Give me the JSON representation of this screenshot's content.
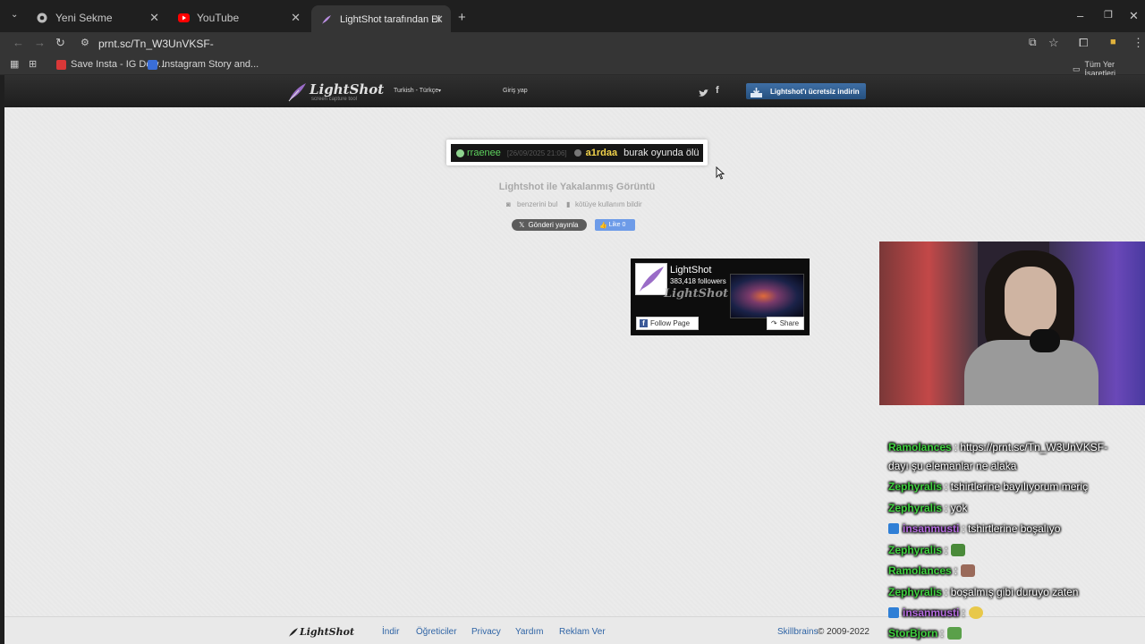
{
  "browser": {
    "tabs": [
      {
        "title": "Yeni Sekme",
        "icon": "chrome-icon"
      },
      {
        "title": "YouTube",
        "icon": "youtube-icon"
      },
      {
        "title": "LightShot tarafından Ekran Gör",
        "icon": "lightshot-feather-icon"
      }
    ],
    "url": "prnt.sc/Tn_W3UnVKSF-",
    "bookmarks": [
      {
        "label": "Save Insta - IG Dow...",
        "color": "#d93838"
      },
      {
        "label": "Instagram Story and...",
        "color": "#3a6ed8"
      }
    ],
    "all_bookmarks": "Tüm Yer İşaretleri"
  },
  "header": {
    "logo": "LightShot",
    "tagline": "screen capture tool",
    "language": "Turkish - Türkçe",
    "login": "Giriş yap",
    "download": "Lightshot'ı ücretsiz indirin"
  },
  "screenshot": {
    "user1": "rraenee",
    "timestamp": "[26/09/2025 21:06]",
    "user2": "a1rdaa",
    "message": "burak oyunda ölü"
  },
  "caption": "Lightshot ile Yakalanmış Görüntü",
  "actions": {
    "find_similar": "benzerini bul",
    "report": "kötüye kullanım bildir"
  },
  "share": {
    "tweet": "Gönderi yayınla",
    "like": "Like 0"
  },
  "fb_widget": {
    "name": "LightShot",
    "followers": "383,418 followers",
    "follow": "Follow Page",
    "share": "Share"
  },
  "footer": {
    "logo": "LightShot",
    "links": [
      "İndir",
      "Öğreticiler",
      "Privacy",
      "Yardım",
      "Reklam Ver"
    ],
    "company": "Skillbrains",
    "copyright": "© 2009-2022"
  },
  "stream_chat": [
    {
      "user": "Ramolances",
      "color": "#3fd13f",
      "text": ": https://prnt.sc/Tn_W3UnVKSF-"
    },
    {
      "user": "",
      "color": "#ffffff",
      "text": "dayı şu elemanlar ne alaka"
    },
    {
      "user": "Zephyralis",
      "color": "#3fd13f",
      "text": ": tshirtlerine bayılıyorum meriç"
    },
    {
      "user": "Zephyralis",
      "color": "#3fd13f",
      "text": ": yok"
    },
    {
      "user": "insanmusti",
      "color": "#b56be0",
      "text": ": tshirtlerine boşalıyo"
    },
    {
      "user": "Zephyralis",
      "color": "#3fd13f",
      "text": ":"
    },
    {
      "user": "Ramolances",
      "color": "#3fd13f",
      "text": ":"
    },
    {
      "user": "Zephyralis",
      "color": "#3fd13f",
      "text": ": boşalmış gibi duruyo zaten"
    },
    {
      "user": "insanmusti",
      "color": "#b56be0",
      "text": ":"
    },
    {
      "user": "StorBjorn",
      "color": "#3fd13f",
      "text": ":"
    }
  ]
}
